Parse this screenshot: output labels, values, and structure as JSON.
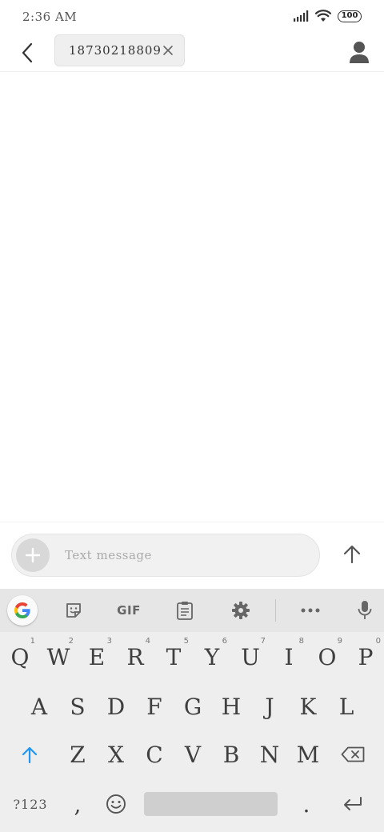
{
  "status_bar": {
    "time": "2:36 AM",
    "battery": "100",
    "icons": [
      "signal-icon",
      "wifi-icon",
      "battery-icon"
    ]
  },
  "header": {
    "recipient": "18730218809",
    "icons": [
      "back-arrow-icon",
      "close-icon",
      "contact-icon"
    ]
  },
  "compose": {
    "placeholder": "Text message",
    "icons": [
      "plus-icon",
      "send-arrow-icon"
    ]
  },
  "keyboard": {
    "toolbar": {
      "gif_label": "GIF",
      "icons": [
        "google-g-icon",
        "sticker-icon",
        "clipboard-icon",
        "gear-icon",
        "more-dots-icon",
        "microphone-icon"
      ]
    },
    "row1": [
      "Q",
      "W",
      "E",
      "R",
      "T",
      "Y",
      "U",
      "I",
      "O",
      "P"
    ],
    "row1_hints": [
      "1",
      "2",
      "3",
      "4",
      "5",
      "6",
      "7",
      "8",
      "9",
      "0"
    ],
    "row2": [
      "A",
      "S",
      "D",
      "F",
      "G",
      "H",
      "J",
      "K",
      "L"
    ],
    "row3": [
      "Z",
      "X",
      "C",
      "V",
      "B",
      "N",
      "M"
    ],
    "symbols_key": "?123",
    "comma": ",",
    "period": ".",
    "accent_color": "#2196f3"
  }
}
